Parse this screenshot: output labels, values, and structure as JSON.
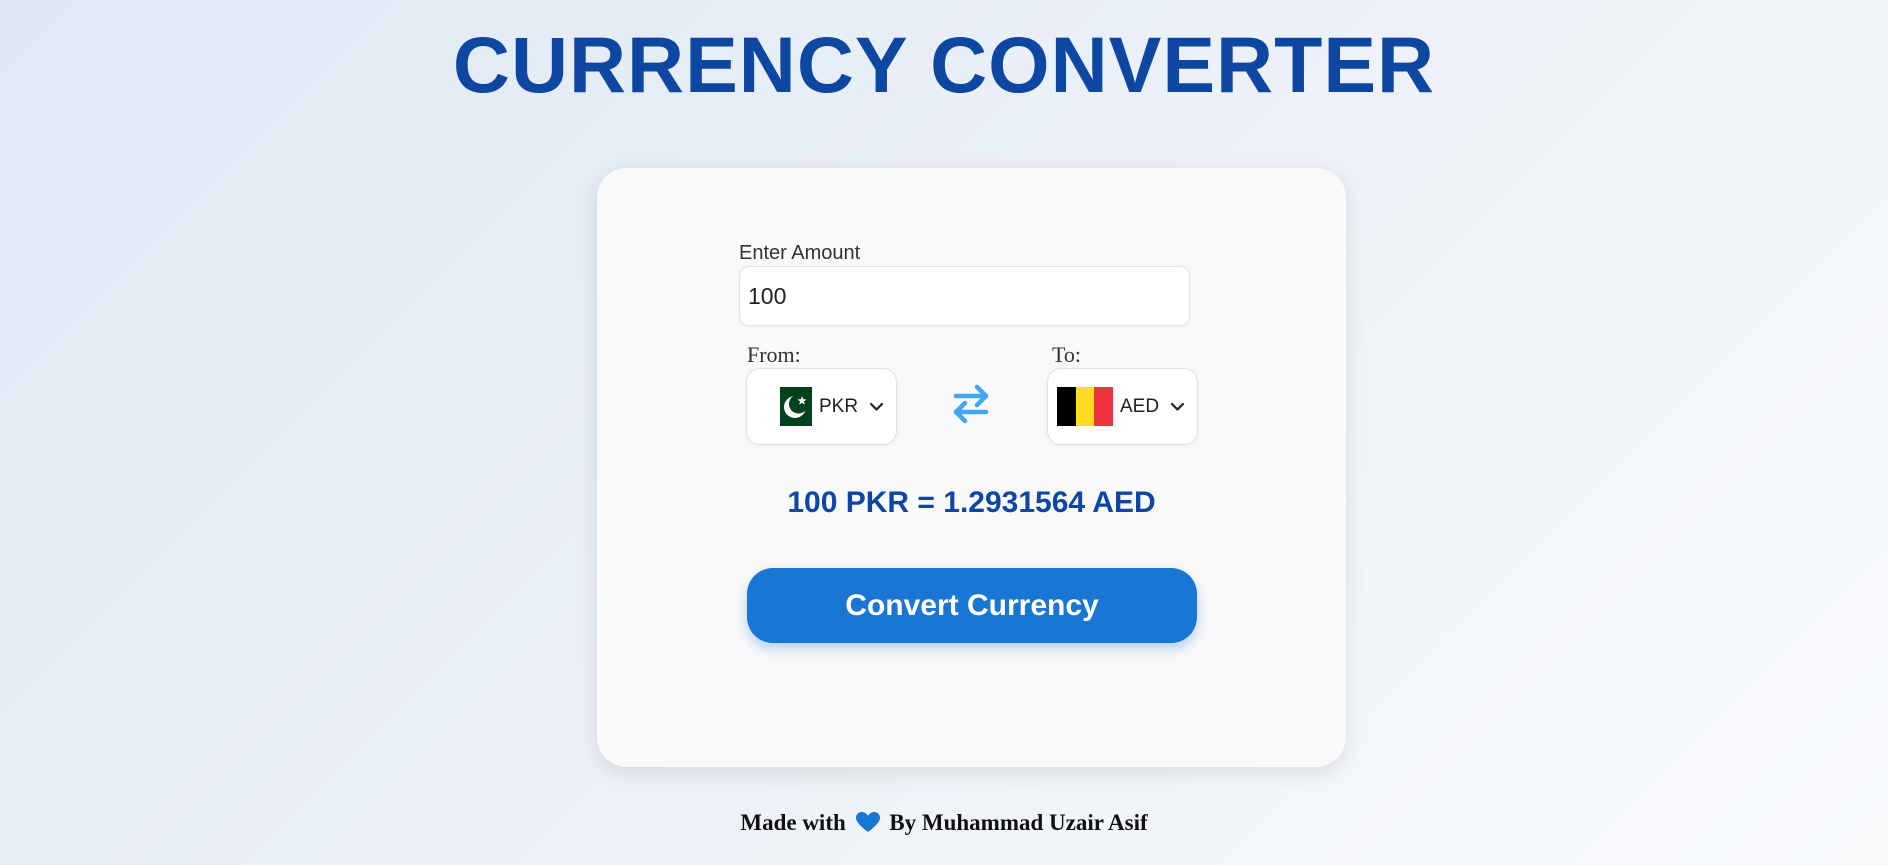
{
  "title": "CURRENCY CONVERTER",
  "amount": {
    "label": "Enter Amount",
    "value": "100"
  },
  "from": {
    "label": "From:",
    "code": "PKR",
    "flag_icon": "pakistan-flag-icon"
  },
  "to": {
    "label": "To:",
    "code": "AED",
    "flag_icon": "belgium-flag-icon"
  },
  "swap_icon": "swap-arrows-icon",
  "result": "100 PKR = 1.2931564 AED",
  "convert_button": "Convert Currency",
  "footer": {
    "prefix": "Made with",
    "heart_icon": "heart-icon",
    "suffix": "By Muhammad Uzair Asif"
  },
  "colors": {
    "primary": "#0d47a1",
    "button": "#1976d2",
    "swap": "#42a5f5",
    "heart": "#1976d2"
  }
}
